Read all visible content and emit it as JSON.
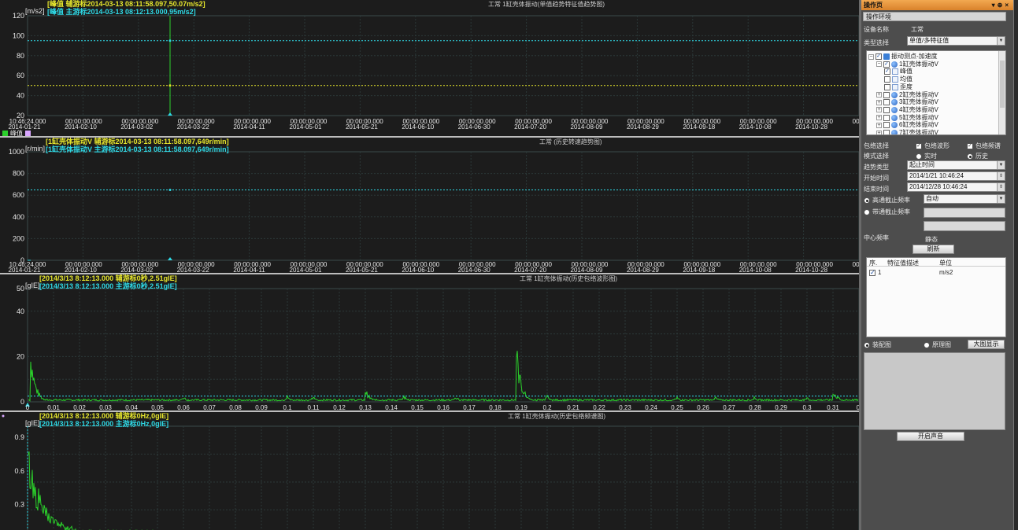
{
  "colors": {
    "bg": "#1c1c1c",
    "grid": "#2e3b3b",
    "yellow": "#e6e62d",
    "cyan": "#2fd9e6",
    "green": "#2bd12b",
    "accent": "#e39236"
  },
  "panel1": {
    "title": "工常 1缸壳体振动(单值趋势特征值趋势图)",
    "cursor_main": "[峰值 辅游标2014-03-13 08:11:58.097,50.07m/s2]",
    "cursor_sub": "[峰值 主游标2014-03-13 08:12:13.000,95m/s2]",
    "unit": "[m/s2]",
    "y_ticks": [
      "120",
      "100",
      "80",
      "60",
      "40",
      "20"
    ],
    "x_times": [
      "10:46:24.000",
      "00:00:00.000",
      "00:00:00.000",
      "00:00:00.000",
      "00:00:00.000",
      "00:00:00.000",
      "00:00:00.000",
      "00:00:00.000",
      "00:00:00.000",
      "00:00:00.000",
      "00:00:00.000",
      "00:00:00.000",
      "00:00:00.000",
      "00:00:00.000",
      "00:00:00.000",
      "00:00:00.000"
    ],
    "x_dates": [
      "2014-01-21",
      "2014-02-10",
      "2014-03-02",
      "2014-03-22",
      "2014-04-11",
      "2014-05-01",
      "2014-05-21",
      "2014-06-10",
      "2014-06-30",
      "2014-07-20",
      "2014-08-09",
      "2014-08-29",
      "2014-09-18",
      "2014-10-08",
      "2014-10-28",
      "20"
    ],
    "legend": "峰值"
  },
  "panel2": {
    "title": "工常 (历史转速趋势图)",
    "cursor_main": "[1缸壳体振动V 辅游标2014-03-13 08:11:58.097,649r/min]",
    "cursor_sub": "[1缸壳体振动V 主游标2014-03-13 08:11:58.097,649r/min]",
    "unit": "[r/min]",
    "y_ticks": [
      "1000",
      "800",
      "600",
      "400",
      "200",
      "0"
    ],
    "x_times": [
      "10:46:24.000",
      "00:00:00.000",
      "00:00:00.000",
      "00:00:00.000",
      "00:00:00.000",
      "00:00:00.000",
      "00:00:00.000",
      "00:00:00.000",
      "00:00:00.000",
      "00:00:00.000",
      "00:00:00.000",
      "00:00:00.000",
      "00:00:00.000",
      "00:00:00.000",
      "00:00:00.000",
      "00:00:00.000"
    ],
    "x_dates": [
      "2014-01-21",
      "2014-02-10",
      "2014-03-02",
      "2014-03-22",
      "2014-04-11",
      "2014-05-01",
      "2014-05-21",
      "2014-06-10",
      "2014-06-30",
      "2014-07-20",
      "2014-08-09",
      "2014-08-29",
      "2014-09-18",
      "2014-10-08",
      "2014-10-28",
      "20"
    ]
  },
  "panel3": {
    "title": "工常 1缸壳体振动(历史包络波形图)",
    "cursor_main": "[2014/3/13 8:12:13.000 辅游标0秒,2.51gIE]",
    "cursor_sub": "[2014/3/13 8:12:13.000 主游标0秒,2.51gIE]",
    "unit": "[gIE]",
    "y_ticks": [
      "50",
      "40",
      "20",
      "0"
    ],
    "x_ticks": [
      "0",
      "0.01",
      "0.02",
      "0.03",
      "0.04",
      "0.05",
      "0.06",
      "0.07",
      "0.08",
      "0.09",
      "0.1",
      "0.11",
      "0.12",
      "0.13",
      "0.14",
      "0.15",
      "0.16",
      "0.17",
      "0.18",
      "0.19",
      "0.2",
      "0.21",
      "0.22",
      "0.23",
      "0.24",
      "0.25",
      "0.26",
      "0.27",
      "0.28",
      "0.29",
      "0.3",
      "0.31",
      "0."
    ]
  },
  "panel4": {
    "title": "工常 1缸壳体振动(历史包络频谱图)",
    "cursor_main": "[2014/3/13 8:12:13.000 辅游标0Hz,0gIE]",
    "cursor_sub": "[2014/3/13 8:12:13.000 主游标0Hz,0gIE]",
    "unit": "[gIE]",
    "y_ticks": [
      "0.9",
      "0.6",
      "0.3"
    ]
  },
  "side": {
    "title": "操作页",
    "tab": "操作环境",
    "device_label": "设备名称",
    "device_value": "工常",
    "type_label": "类型选择",
    "type_value": "单值/多特征值",
    "tree": [
      {
        "label": "振动测点-加速度",
        "level": 0,
        "checked": true
      },
      {
        "label": "1缸壳体振动V",
        "level": 1,
        "checked": true
      },
      {
        "label": "峰值",
        "level": 2,
        "checked": true
      },
      {
        "label": "均值",
        "level": 2,
        "checked": false
      },
      {
        "label": "歪度",
        "level": 2,
        "checked": false
      },
      {
        "label": "2缸壳体振动V",
        "level": 1,
        "checked": false
      },
      {
        "label": "3缸壳体振动V",
        "level": 1,
        "checked": false
      },
      {
        "label": "4缸壳体振动V",
        "level": 1,
        "checked": false
      },
      {
        "label": "5缸壳体振动V",
        "level": 1,
        "checked": false
      },
      {
        "label": "6缸壳体振动V",
        "level": 1,
        "checked": false
      },
      {
        "label": "7缸壳体振动V",
        "level": 1,
        "checked": false
      }
    ],
    "env_label": "包络选择",
    "env_wave": "包络波形",
    "env_spec": "包络频谱",
    "mode_label": "模式选择",
    "mode_realtime": "实时",
    "mode_history": "历史",
    "trend_label": "趋势类型",
    "trend_value": "起止时间",
    "start_label": "开始时间",
    "start_value": "2014/1/21 10:46:24",
    "end_label": "结束时间",
    "end_value": "2014/12/28 10:46:24",
    "highpass_label": "高通截止频率",
    "highpass_value": "自动",
    "bandpass_label": "带通截止频率",
    "center_label": "中心频率",
    "center_value": "静态",
    "refresh": "刷新",
    "grid_headers": [
      "序.",
      "特征值描述",
      "单位"
    ],
    "grid_row": [
      "1",
      "m/s2"
    ],
    "assembly": "装配图",
    "principle": "原理图",
    "big_display": "大图显示",
    "sound": "开启声音"
  },
  "chart_data": [
    {
      "type": "line",
      "title": "工常 1缸壳体振动(单值趋势特征值趋势图)",
      "ylabel": "[m/s2]",
      "ylim": [
        20,
        120
      ],
      "x": [
        "2014-03-13 08:11:58.097",
        "2014-03-13 08:12:13.000"
      ],
      "series": [
        {
          "name": "峰值",
          "values": [
            50.07,
            95
          ]
        }
      ]
    },
    {
      "type": "line",
      "title": "工常 (历史转速趋势图)",
      "ylabel": "[r/min]",
      "ylim": [
        0,
        1000
      ],
      "x": [
        "2014-03-13 08:11:58.097"
      ],
      "series": [
        {
          "values": [
            649
          ]
        }
      ]
    },
    {
      "type": "line",
      "title": "工常 1缸壳体振动(历史包络波形图)",
      "ylabel": "[gIE]",
      "ylim": [
        0,
        50
      ],
      "xlim": [
        0,
        0.32
      ],
      "peaks": [
        [
          0.001,
          26
        ],
        [
          0.13,
          6
        ],
        [
          0.188,
          28
        ],
        [
          0.31,
          6
        ]
      ]
    },
    {
      "type": "line",
      "title": "工常 1缸壳体振动(历史包络频谱图)",
      "ylabel": "[gIE]",
      "ylim": [
        0,
        1.0
      ],
      "peaks": [
        [
          0,
          0.78
        ]
      ]
    }
  ]
}
